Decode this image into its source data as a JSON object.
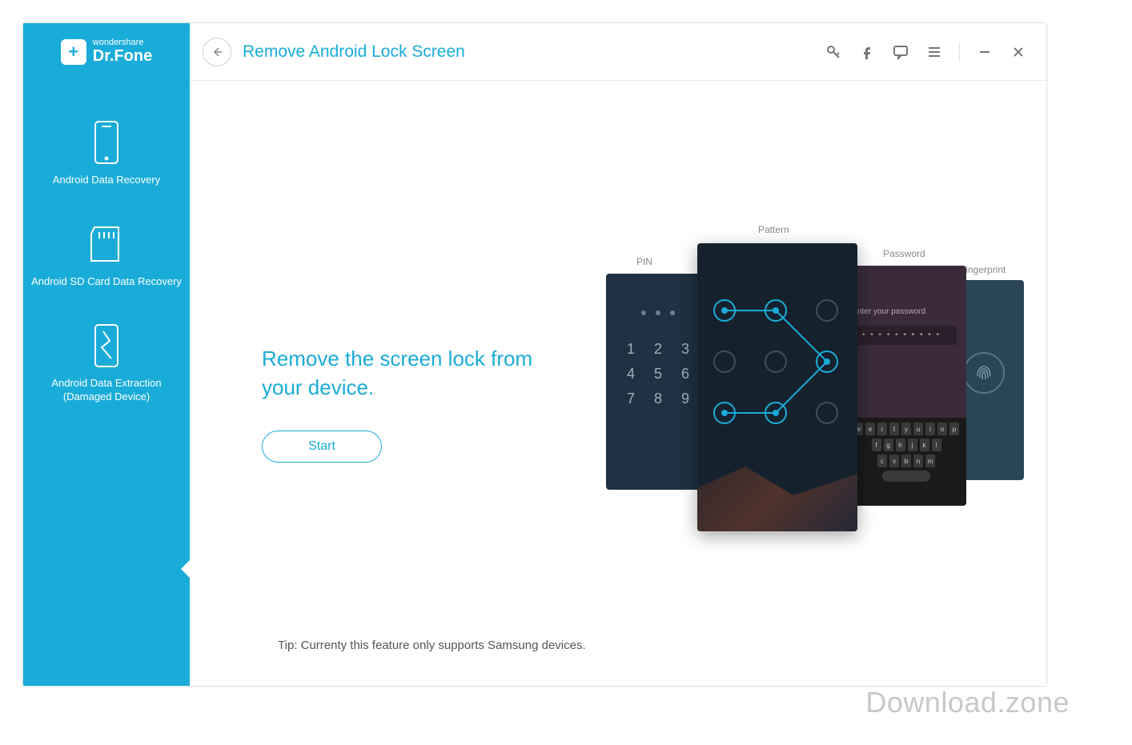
{
  "brand": {
    "line1": "wondershare",
    "line2": "Dr.Fone"
  },
  "sidebar": {
    "items": [
      {
        "label": "Android Data Recovery"
      },
      {
        "label": "Android SD Card Data Recovery"
      },
      {
        "label": "Android Data Extraction (Damaged Device)"
      }
    ]
  },
  "header": {
    "title": "Remove Android Lock Screen"
  },
  "main": {
    "headline": "Remove the screen lock from your device.",
    "start_label": "Start",
    "tip": "Tip: Currenty this feature only supports Samsung devices."
  },
  "illustration": {
    "labels": {
      "pin": "PIN",
      "pattern": "Pattern",
      "password": "Password",
      "fingerprint": "Fingerprint"
    },
    "password_placeholder": "nter your password",
    "password_mask": "• • • • • • • • • •",
    "keypad": [
      "1",
      "2",
      "3",
      "4",
      "5",
      "6",
      "7",
      "8",
      "9"
    ],
    "kbd_rows": [
      [
        "w",
        "e",
        "r",
        "t",
        "y",
        "u",
        "i",
        "o",
        "p"
      ],
      [
        "f",
        "g",
        "h",
        "j",
        "k",
        "l"
      ],
      [
        "c",
        "v",
        "b",
        "n",
        "m"
      ]
    ]
  },
  "watermark": "Download.zone"
}
